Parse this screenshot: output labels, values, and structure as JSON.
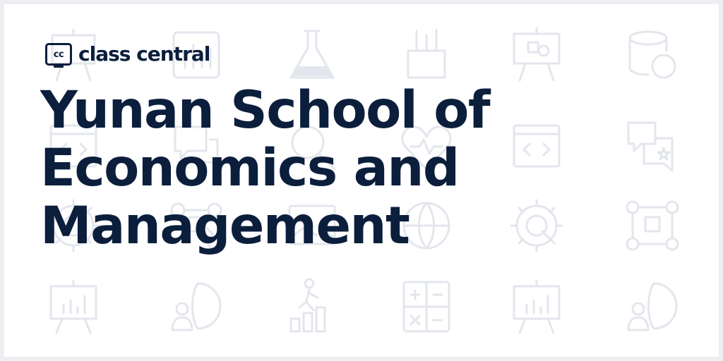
{
  "brand": {
    "logo_text": "cc",
    "name": "class central"
  },
  "title_lines": [
    "Yunan School of",
    "Economics and",
    "Management"
  ],
  "colors": {
    "text": "#0b1e3c",
    "background": "#ffffff",
    "pattern": "#e3e6ec",
    "frame": "#eceef1"
  },
  "background_icons": [
    "presentation-board-icon",
    "bar-chart-icon",
    "flask-icon",
    "pencil-cup-icon",
    "presentation-board-icon",
    "database-chart-icon",
    "code-window-icon",
    "star-chat-icon",
    "magnifier-icon",
    "heart-pulse-icon",
    "code-window-icon",
    "star-chat-icon",
    "gear-icon",
    "flowchart-icon",
    "picture-icon",
    "globe-icon",
    "gear-icon",
    "flowchart-icon",
    "presentation-chart-icon",
    "globe-person-icon",
    "climbing-person-icon",
    "calculator-icon",
    "presentation-chart-icon",
    "globe-person-icon"
  ]
}
